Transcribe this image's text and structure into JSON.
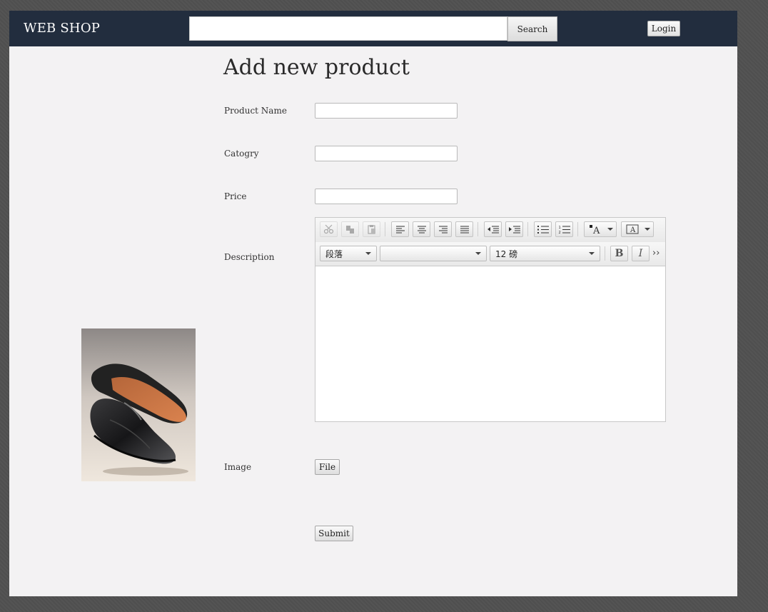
{
  "header": {
    "brand": "WEB SHOP",
    "search": {
      "value": "",
      "placeholder": "",
      "button_label": "Search"
    },
    "login_label": "Login"
  },
  "form": {
    "title": "Add new product",
    "fields": {
      "product_name": {
        "label": "Product Name",
        "value": ""
      },
      "category": {
        "label": "Catogry",
        "value": ""
      },
      "price": {
        "label": "Price",
        "value": ""
      },
      "description": {
        "label": "Description"
      },
      "image": {
        "label": "Image",
        "button_label": "File"
      }
    },
    "submit_label": "Submit"
  },
  "editor": {
    "toolbar_row1": [
      "cut-icon",
      "copy-icon",
      "paste-icon",
      "align-left-icon",
      "align-center-icon",
      "align-right-icon",
      "align-justify-icon",
      "outdent-icon",
      "indent-icon",
      "bullet-list-icon",
      "numbered-list-icon",
      "text-color-icon",
      "background-color-icon"
    ],
    "format_select": "段落",
    "font_family_select": "",
    "font_size_select": "12 磅",
    "bold_label": "B",
    "italic_label": "I",
    "more_label": "››",
    "content": ""
  },
  "colors": {
    "header_bg": "#222d3e",
    "page_bg": "#f3f2f3",
    "outer_bg": "#4f4f4f"
  }
}
